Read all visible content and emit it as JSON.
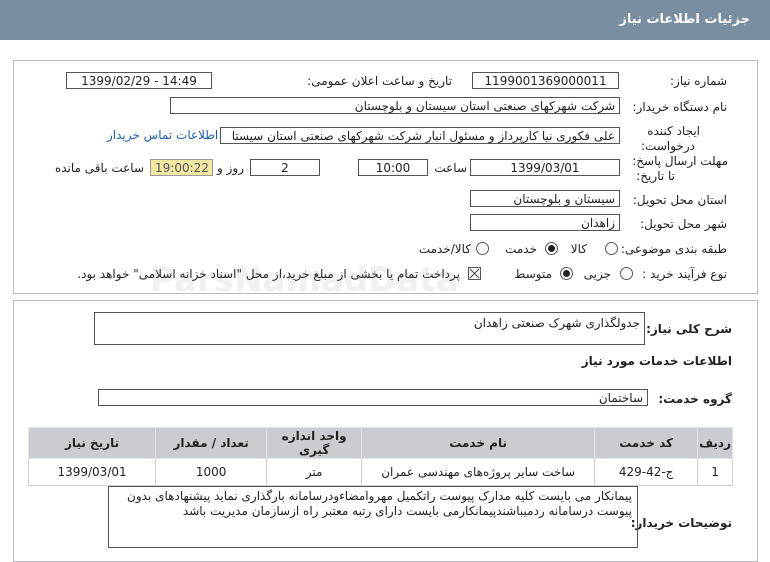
{
  "header": {
    "title": "جزئیات اطلاعات نیاز"
  },
  "form": {
    "need_number_label": "شماره نیاز:",
    "need_number": "1199001369000011",
    "announce_label": "تاریخ و ساعت اعلان عمومی:",
    "announce_value": "1399/02/29 - 14:49",
    "buyer_org_label": "نام دستگاه خریدار:",
    "buyer_org": "شرکت شهرکهای صنعتی استان سیستان و بلوچستان",
    "requester_label_1": "ایجاد کننده",
    "requester_label_2": "درخواست:",
    "requester": "علی  فکوری نیا کارپرداز و مسئول انبار شرکت شهرکهای صنعتی استان سیستا",
    "contact_link": "اطلاعات تماس خریدار",
    "deadline_label_1": "مهلت ارسال پاسخ:",
    "deadline_label_2": "تا تاریخ:",
    "deadline_date": "1399/03/01",
    "time_label": "ساعت",
    "deadline_time": "10:00",
    "days_value": "2",
    "days_label": "روز و",
    "remaining_time": "19:00:22",
    "remaining_label": "ساعت باقی مانده",
    "province_label": "استان محل تحویل:",
    "province": "سیستان و بلوچستان",
    "city_label": "شهر محل تحویل:",
    "city": "زاهدان",
    "category_label": "طبقه بندی موضوعی:",
    "category_options": [
      "کالا",
      "خدمت",
      "کالا/خدمت"
    ],
    "category_selected": "خدمت",
    "purchase_label": "نوع فرآیند خرید :",
    "purchase_options": [
      "جزیی",
      "متوسط"
    ],
    "purchase_selected": "متوسط",
    "payment_note": "پرداخت تمام یا بخشی از مبلغ خرید،از محل \"اسناد خزانه اسلامی\" خواهد بود."
  },
  "details": {
    "summary_label": "شرح کلی نیاز:",
    "summary": "جدولگذاری شهرک صنعتی زاهدان",
    "services_title": "اطلاعات خدمات مورد نیاز",
    "group_label": "گروه خدمت:",
    "group": "ساختمان",
    "table": {
      "headers": [
        "ردیف",
        "کد خدمت",
        "نام خدمت",
        "واحد اندازه گیری",
        "تعداد / مقدار",
        "تاریخ نیاز"
      ],
      "rows": [
        [
          "1",
          "ج-42-429",
          "ساخت سایر پروژه‌های مهندسی عمران",
          "متر",
          "1000",
          "1399/03/01"
        ]
      ]
    },
    "notes_label": "توضیحات خریدار:",
    "notes": "پیمانکار می بایست کلیه مدارک پیوست راتکمیل مهروامضاءودرسامانه بارگذاری نماید پیشنهادهای بدون پیوست  درسامانه ردمیباشندپیمانکارمی بایست دارای رتبه معتبر راه ازسازمان مدیریت باشد"
  },
  "watermark": "ParsNamadData"
}
